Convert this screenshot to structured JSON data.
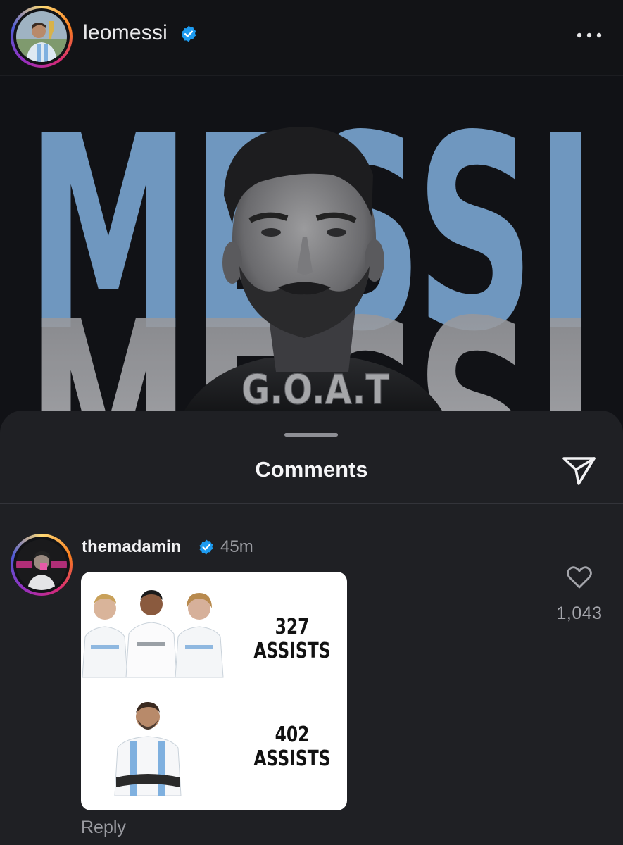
{
  "post": {
    "username": "leomessi",
    "verified": true,
    "more_icon": "more-horizontal-icon",
    "image": {
      "big_text": "MESSI",
      "overlay_text": "G.O.A.T"
    }
  },
  "comments_sheet": {
    "title": "Comments",
    "share_icon": "send-icon",
    "comments": [
      {
        "username": "themadamin",
        "verified": true,
        "time": "45m",
        "image": {
          "stat1_value": "327",
          "stat1_label": "ASSISTS",
          "stat2_value": "402",
          "stat2_label": "ASSISTS"
        },
        "like_icon": "heart-outline-icon",
        "likes": "1,043",
        "reply_label": "Reply"
      }
    ]
  },
  "colors": {
    "background": "#121316",
    "sheet": "#1f2024",
    "verified_blue": "#1d9bf0",
    "messi_blue": "#6f97bf",
    "secondary_text": "#9a9ba1"
  }
}
